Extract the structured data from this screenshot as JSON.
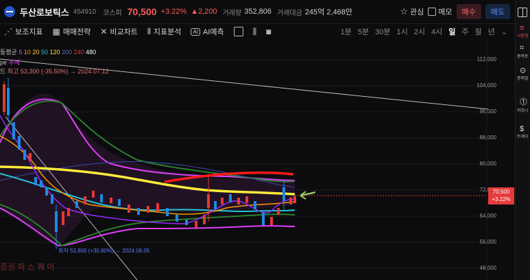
{
  "header": {
    "stock_name": "두산로보틱스",
    "code": "454910",
    "market": "코스피",
    "price": "70,500",
    "change_pct": "+3.22%",
    "change_amt": "▲2,200",
    "volume_label": "거래량",
    "volume": "352,806",
    "amount_label": "거래대금",
    "amount": "245억 2,468만",
    "fav_label": "관심",
    "memo_label": "메모",
    "buy_label": "매수",
    "sell_label": "매도"
  },
  "toolbar": {
    "items": [
      "보조지표",
      "매매전략",
      "비교차트",
      "지표분석",
      "AI예측"
    ],
    "timeframes": [
      "1분",
      "5분",
      "30분",
      "1시",
      "2시",
      "4시",
      "일",
      "주",
      "월",
      "년"
    ],
    "active_timeframe": "일"
  },
  "legend": {
    "ma_label": "동평균",
    "ma_periods": [
      "5",
      "10",
      "20",
      "50",
      "120",
      "200",
      "240",
      "480"
    ],
    "ma_colors": [
      "#e040fb",
      "#ff9800",
      "#ffd54f",
      "#26c6da",
      "#ffeb3b",
      "#3f51b5",
      "#e53935",
      "#ffffff"
    ],
    "line2_a": "pe",
    "line2_b": "추세",
    "line3": "드",
    "line3_b": "최고",
    "line3_detail": "53,300 (-35.50%) → 2024.07.12"
  },
  "chart": {
    "y_ticks": [
      "112,000",
      "104,000",
      "96,000",
      "88,000",
      "80,000",
      "72,000",
      "64,000",
      "56,000",
      "48,000"
    ],
    "current_price": "70,500",
    "current_change": "+3.22%",
    "low_annotation": "최저 53,900 (+30.80%) → 2024.08.05",
    "watermark": "증권 파 스 퀘 어"
  },
  "sidebar": {
    "items": [
      {
        "label": "시장정",
        "icon": "≡"
      },
      {
        "label": "종목토",
        "icon": "⌗"
      },
      {
        "label": "종목발",
        "icon": "⊙"
      },
      {
        "label": "커뮤니",
        "icon": "⓵"
      },
      {
        "label": "트레이",
        "icon": "$"
      }
    ]
  }
}
